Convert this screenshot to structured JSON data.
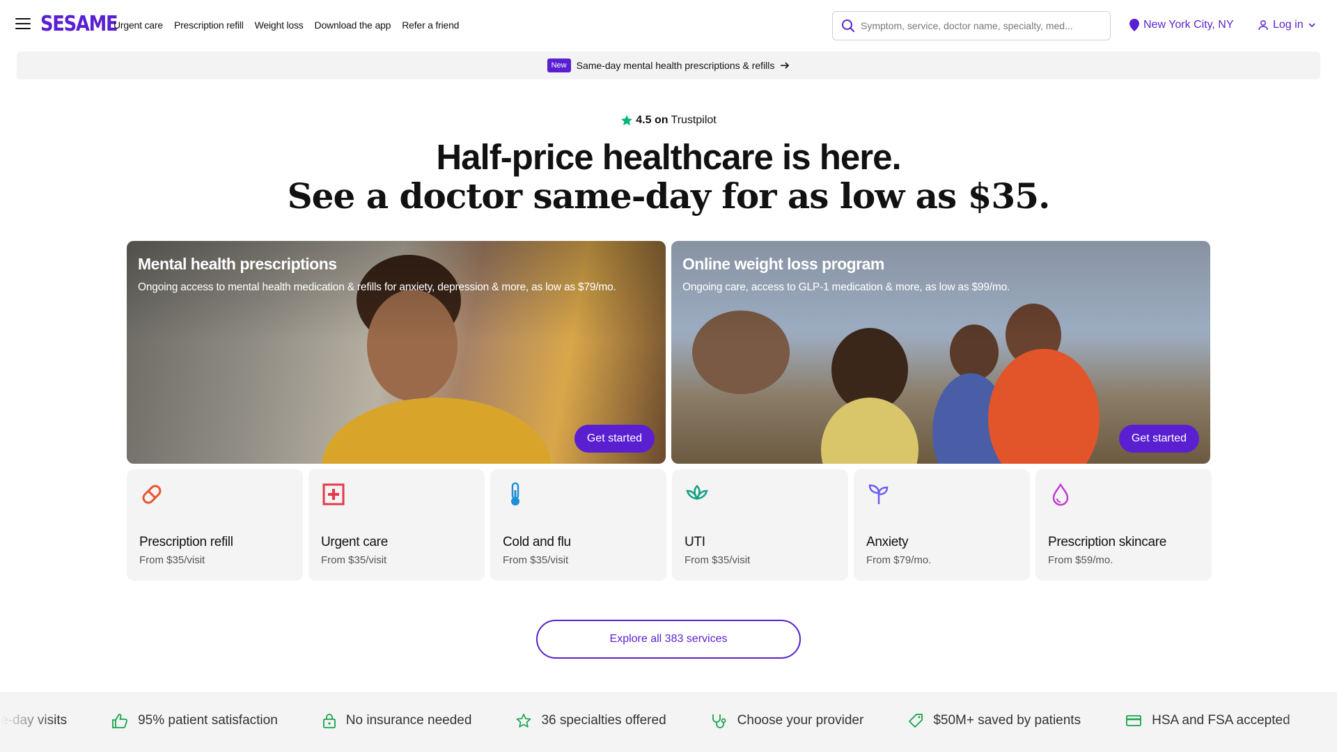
{
  "header": {
    "logo": "SESAME",
    "nav": [
      "Urgent care",
      "Prescription refill",
      "Weight loss",
      "Download the app",
      "Refer a friend"
    ],
    "search_placeholder": "Symptom, service, doctor name, specialty, med...",
    "location": "New York City, NY",
    "login": "Log in"
  },
  "banner": {
    "badge": "New",
    "text": "Same-day mental health prescriptions & refills"
  },
  "hero": {
    "rating": "4.5 on",
    "rating_source": "Trustpilot",
    "title": "Half-price healthcare is here.",
    "subtitle": "See a doctor same-day for as low as $35."
  },
  "features": [
    {
      "title": "Mental health prescriptions",
      "description": "Ongoing access to mental health medication & refills for anxiety, depression & more, as low as $79/mo.",
      "cta": "Get started"
    },
    {
      "title": "Online weight loss program",
      "description": "Ongoing care, access to GLP-1 medication & more, as low as $99/mo.",
      "cta": "Get started"
    }
  ],
  "services": [
    {
      "name": "Prescription refill",
      "price": "From $35/visit",
      "icon": "pill-icon",
      "color": "#e8542c"
    },
    {
      "name": "Urgent care",
      "price": "From $35/visit",
      "icon": "first-aid-icon",
      "color": "#e23b4a"
    },
    {
      "name": "Cold and flu",
      "price": "From $35/visit",
      "icon": "thermometer-icon",
      "color": "#1e8fd6"
    },
    {
      "name": "UTI",
      "price": "From $35/visit",
      "icon": "lotus-icon",
      "color": "#16a085"
    },
    {
      "name": "Anxiety",
      "price": "From $79/mo.",
      "icon": "sprout-icon",
      "color": "#6a5cf0"
    },
    {
      "name": "Prescription skincare",
      "price": "From $59/mo.",
      "icon": "droplet-icon",
      "color": "#c23bd4"
    }
  ],
  "explore": "Explore all 383 services",
  "stats": [
    {
      "label": "Same-day visits",
      "icon": "calendar-icon"
    },
    {
      "label": "95% patient satisfaction",
      "icon": "thumbs-up-icon"
    },
    {
      "label": "No insurance needed",
      "icon": "lock-icon"
    },
    {
      "label": "36 specialties offered",
      "icon": "star-icon"
    },
    {
      "label": "Choose your provider",
      "icon": "provider-icon"
    },
    {
      "label": "$50M+ saved by patients",
      "icon": "tag-icon"
    },
    {
      "label": "HSA and FSA accepted",
      "icon": "card-icon"
    }
  ],
  "colors": {
    "brand": "#5a1fd1",
    "trust_star": "#00b67a",
    "stat_icon": "#16a34a"
  }
}
